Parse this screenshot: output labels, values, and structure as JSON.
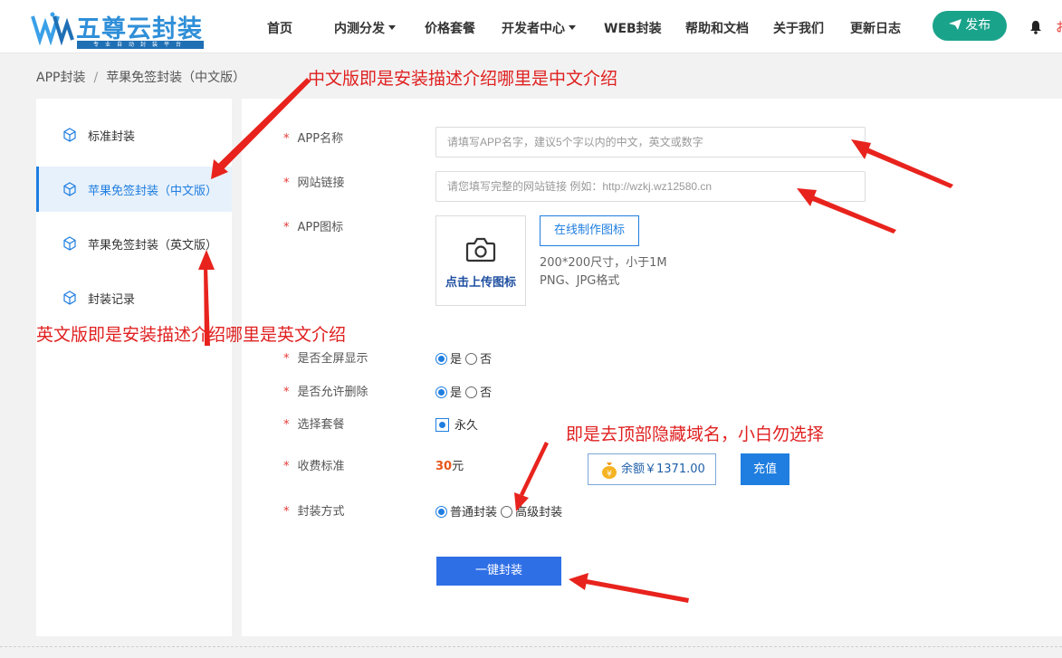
{
  "brand": {
    "name": "五尊云封装",
    "tagline": "专业自动封装平台"
  },
  "nav": {
    "items": [
      {
        "label": "首页",
        "dropdown": false
      },
      {
        "label": "内测分发",
        "dropdown": true
      },
      {
        "label": "价格套餐",
        "dropdown": false
      },
      {
        "label": "开发者中心",
        "dropdown": true
      },
      {
        "label": "WEB封装",
        "dropdown": false
      },
      {
        "label": "帮助和文档",
        "dropdown": false
      },
      {
        "label": "关于我们",
        "dropdown": false
      },
      {
        "label": "更新日志",
        "dropdown": false
      }
    ],
    "publish_label": "发布",
    "more_text": "お"
  },
  "breadcrumb": {
    "root": "APP封装",
    "separator": "/",
    "current": "苹果免签封装（中文版）"
  },
  "sidebar": {
    "items": [
      {
        "label": "标准封装",
        "active": false
      },
      {
        "label": "苹果免签封装（中文版）",
        "active": true
      },
      {
        "label": "苹果免签封装（英文版）",
        "active": false
      },
      {
        "label": "封装记录",
        "active": false
      }
    ]
  },
  "form": {
    "required_mark": "*",
    "app_name": {
      "label": "APP名称",
      "placeholder": "请填写APP名字，建议5个字以内的中文，英文或数字",
      "value": ""
    },
    "site_link": {
      "label": "网站链接",
      "placeholder": "请您填写完整的网站链接 例如：http://wzkj.wz12580.cn",
      "value": ""
    },
    "app_icon": {
      "label": "APP图标",
      "upload_text": "点击上传图标",
      "make_button": "在线制作图标",
      "hint_size": "200*200尺寸，小于1M",
      "hint_format": "PNG、JPG格式"
    },
    "fullscreen": {
      "label": "是否全屏显示",
      "options": [
        "是",
        "否"
      ],
      "selected": "是"
    },
    "allow_delete": {
      "label": "是否允许删除",
      "options": [
        "是",
        "否"
      ],
      "selected": "是"
    },
    "package": {
      "label": "选择套餐",
      "option": "永久"
    },
    "fee": {
      "label": "收费标准",
      "amount": "30",
      "unit": "元"
    },
    "balance": {
      "text": "余额￥1371.00",
      "recharge_label": "充值"
    },
    "method": {
      "label": "封装方式",
      "options": [
        "普通封装",
        "高级封装"
      ],
      "selected": "普通封装"
    },
    "submit_label": "一键封装"
  },
  "annotations": [
    "中文版即是安装描述介绍哪里是中文介绍",
    "英文版即是安装描述介绍哪里是英文介绍",
    "即是去顶部隐藏域名，小白勿选择"
  ],
  "colors": {
    "primary": "#1f7ee0",
    "publish": "#1aa38b",
    "annotation": "#e02020",
    "price": "#e8561a",
    "submit": "#2f6fe6"
  }
}
